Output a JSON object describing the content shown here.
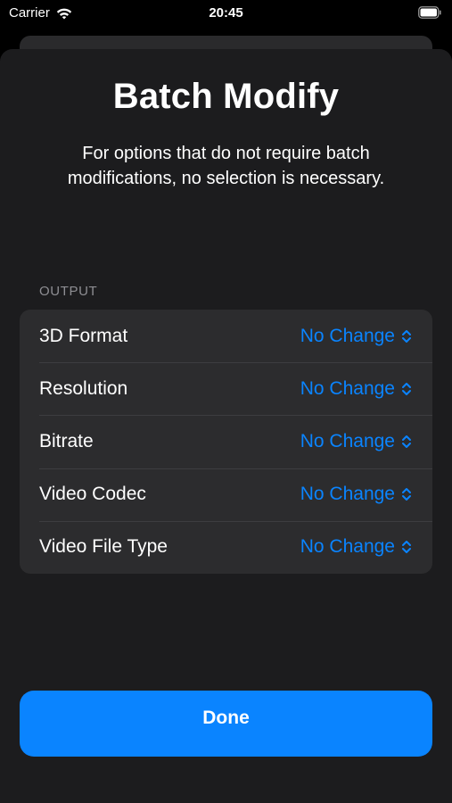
{
  "status_bar": {
    "carrier": "Carrier",
    "time": "20:45"
  },
  "sheet": {
    "title": "Batch Modify",
    "subtitle": "For options that do not require batch modifications, no selection is necessary.",
    "section_header": "OUTPUT",
    "rows": [
      {
        "label": "3D Format",
        "value": "No Change"
      },
      {
        "label": "Resolution",
        "value": "No Change"
      },
      {
        "label": "Bitrate",
        "value": "No Change"
      },
      {
        "label": "Video Codec",
        "value": "No Change"
      },
      {
        "label": "Video File Type",
        "value": "No Change"
      }
    ],
    "done_label": "Done"
  },
  "colors": {
    "accent": "#0a84ff",
    "sheet_background": "#1c1c1e",
    "group_background": "#2c2c2e",
    "secondary_text": "#8e8e93"
  },
  "icons": [
    "wifi-icon",
    "battery-icon",
    "chevron-up-down-icon"
  ]
}
